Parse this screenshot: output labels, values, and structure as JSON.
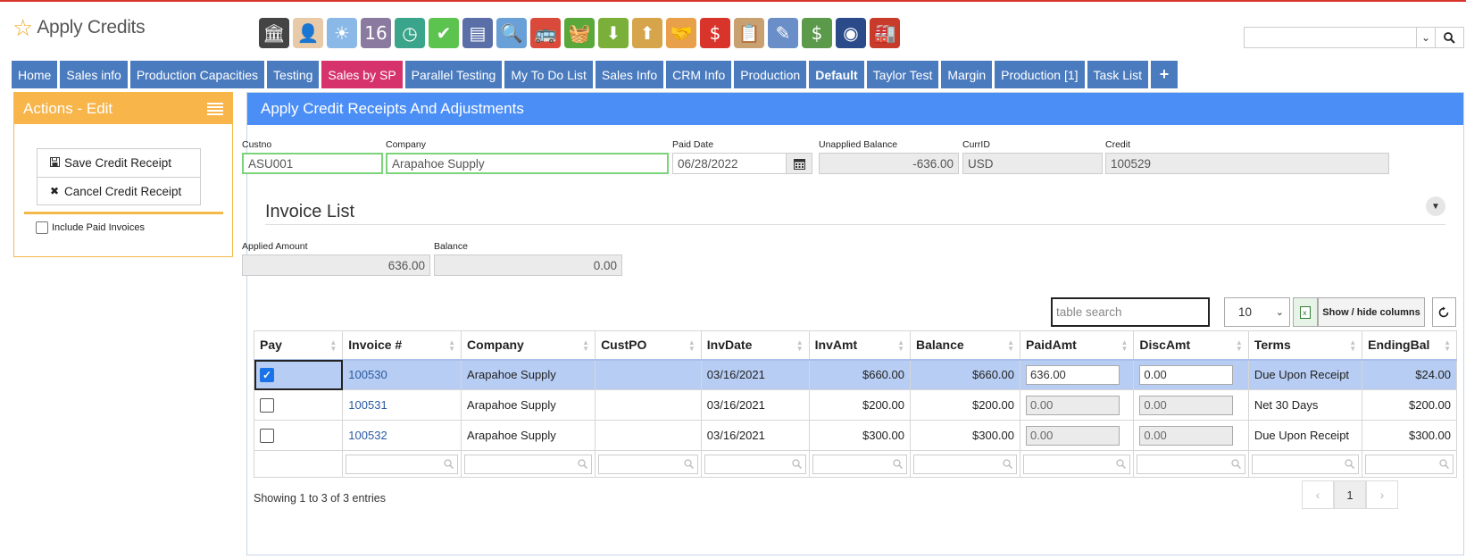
{
  "app": {
    "title": "Apply Credits"
  },
  "toolbar": {
    "icons": [
      {
        "name": "bank-icon",
        "color": "#444444",
        "glyph": "🏛"
      },
      {
        "name": "user-icon",
        "color": "#e8c9a8",
        "glyph": "👤"
      },
      {
        "name": "weather-icon",
        "color": "#8ab9e8",
        "glyph": "☀"
      },
      {
        "name": "calendar-icon",
        "color": "#8a7aa0",
        "glyph": "16"
      },
      {
        "name": "clock-icon",
        "color": "#3aa58a",
        "glyph": "◷"
      },
      {
        "name": "checkmark-icon",
        "color": "#5cc34e",
        "glyph": "✔"
      },
      {
        "name": "news-icon",
        "color": "#5a6fa8",
        "glyph": "▤"
      },
      {
        "name": "magnifier-icon",
        "color": "#6aa0d8",
        "glyph": "🔍"
      },
      {
        "name": "bus-icon",
        "color": "#d94a3a",
        "glyph": "🚌"
      },
      {
        "name": "basket-icon",
        "color": "#5aa83a",
        "glyph": "🧺"
      },
      {
        "name": "download-box-icon",
        "color": "#7ab03a",
        "glyph": "⬇"
      },
      {
        "name": "upload-box-icon",
        "color": "#d6a44a",
        "glyph": "⬆"
      },
      {
        "name": "handshake-icon",
        "color": "#e8a04a",
        "glyph": "🤝"
      },
      {
        "name": "dollar-bubble-icon",
        "color": "#d9342b",
        "glyph": "$"
      },
      {
        "name": "clipboard-icon",
        "color": "#c9a070",
        "glyph": "📋"
      },
      {
        "name": "pencil-icon",
        "color": "#6a8ec8",
        "glyph": "✎"
      },
      {
        "name": "money-icon",
        "color": "#5a9a4a",
        "glyph": "$"
      },
      {
        "name": "gauge-book-icon",
        "color": "#2a4a8a",
        "glyph": "◉"
      },
      {
        "name": "factory-icon",
        "color": "#c83a2a",
        "glyph": "🏭"
      }
    ]
  },
  "search": {
    "value": ""
  },
  "tabs": [
    {
      "label": "Home",
      "style": ""
    },
    {
      "label": "Sales info",
      "style": ""
    },
    {
      "label": "Production Capacities",
      "style": ""
    },
    {
      "label": "Testing",
      "style": ""
    },
    {
      "label": "Sales by SP",
      "style": "pink"
    },
    {
      "label": "Parallel Testing",
      "style": ""
    },
    {
      "label": "My To Do List",
      "style": ""
    },
    {
      "label": "Sales Info",
      "style": ""
    },
    {
      "label": "CRM Info",
      "style": ""
    },
    {
      "label": "Production",
      "style": ""
    },
    {
      "label": "Default",
      "style": "bold"
    },
    {
      "label": "Taylor Test",
      "style": ""
    },
    {
      "label": "Margin",
      "style": ""
    },
    {
      "label": "Production [1]",
      "style": ""
    },
    {
      "label": "Task List",
      "style": ""
    }
  ],
  "tab_add_label": "+",
  "actions": {
    "title": "Actions - Edit",
    "save_label": "Save Credit Receipt",
    "cancel_label": "Cancel Credit Receipt",
    "include_paid_label": "Include Paid Invoices",
    "include_paid_checked": false
  },
  "main": {
    "title": "Apply Credit Receipts And Adjustments",
    "custno_label": "Custno",
    "custno": "ASU001",
    "company_label": "Company",
    "company": "Arapahoe Supply",
    "paid_date_label": "Paid Date",
    "paid_date": "06/28/2022",
    "unapplied_label": "Unapplied Balance",
    "unapplied": "-636.00",
    "currid_label": "CurrID",
    "currid": "USD",
    "credit_label": "Credit",
    "credit": "100529",
    "invoice_list_title": "Invoice List",
    "applied_label": "Applied Amount",
    "applied": "636.00",
    "balance_label": "Balance",
    "balance": "0.00",
    "table_search_placeholder": "table search",
    "page_length": "10",
    "show_hide_label": "Show / hide columns",
    "info": "Showing 1 to 3 of 3 entries",
    "pager": {
      "prev": "‹",
      "page": "1",
      "next": "›"
    }
  },
  "table": {
    "columns": [
      "Pay",
      "Invoice #",
      "Company",
      "CustPO",
      "InvDate",
      "InvAmt",
      "Balance",
      "PaidAmt",
      "DiscAmt",
      "Terms",
      "EndingBal"
    ],
    "rows": [
      {
        "pay": true,
        "invoice": "100530",
        "company": "Arapahoe Supply",
        "custpo": "",
        "invdate": "03/16/2021",
        "invamt": "$660.00",
        "balance": "$660.00",
        "paidamt": "636.00",
        "discamt": "0.00",
        "terms": "Due Upon Receipt",
        "endingbal": "$24.00",
        "editable": true
      },
      {
        "pay": false,
        "invoice": "100531",
        "company": "Arapahoe Supply",
        "custpo": "",
        "invdate": "03/16/2021",
        "invamt": "$200.00",
        "balance": "$200.00",
        "paidamt": "0.00",
        "discamt": "0.00",
        "terms": "Net 30 Days",
        "endingbal": "$200.00",
        "editable": false
      },
      {
        "pay": false,
        "invoice": "100532",
        "company": "Arapahoe Supply",
        "custpo": "",
        "invdate": "03/16/2021",
        "invamt": "$300.00",
        "balance": "$300.00",
        "paidamt": "0.00",
        "discamt": "0.00",
        "terms": "Due Upon Receipt",
        "endingbal": "$300.00",
        "editable": false
      }
    ]
  }
}
